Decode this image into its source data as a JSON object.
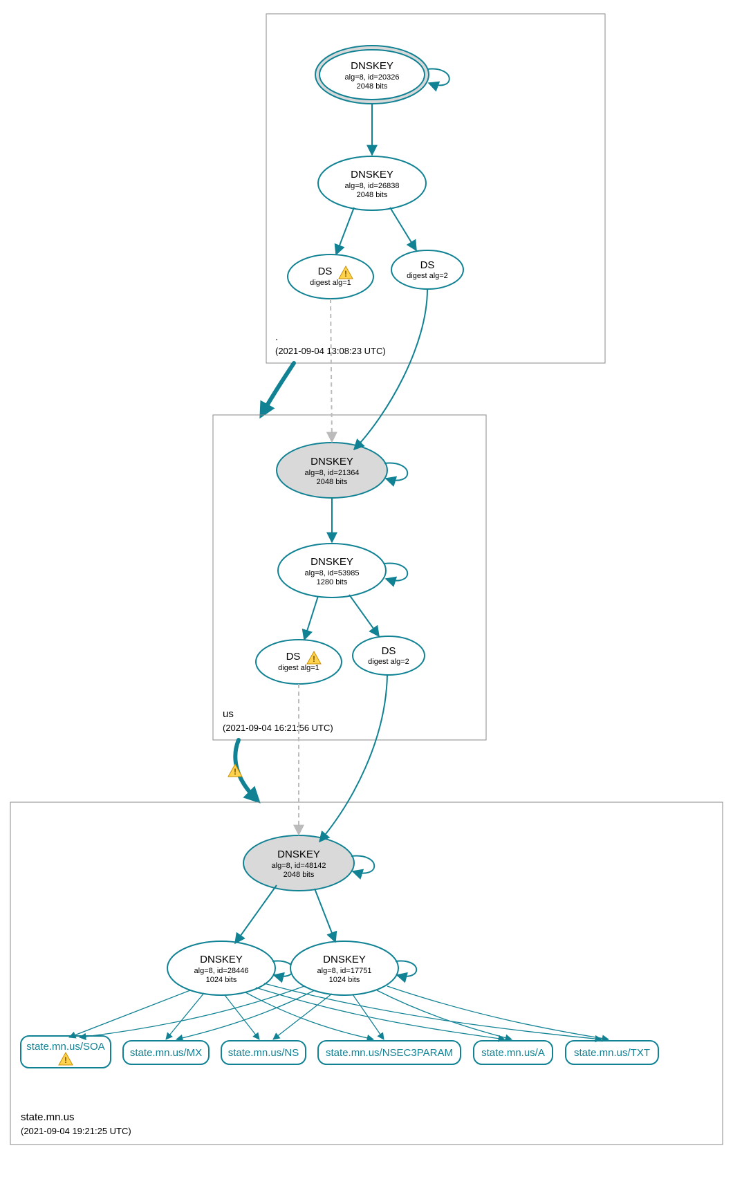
{
  "zones": {
    "root": {
      "name": ".",
      "timestamp": "(2021-09-04 13:08:23 UTC)"
    },
    "us": {
      "name": "us",
      "timestamp": "(2021-09-04 16:21:56 UTC)"
    },
    "statemnus": {
      "name": "state.mn.us",
      "timestamp": "(2021-09-04 19:21:25 UTC)"
    }
  },
  "nodes": {
    "root_ksk": {
      "title": "DNSKEY",
      "sub1": "alg=8, id=20326",
      "sub2": "2048 bits"
    },
    "root_zsk": {
      "title": "DNSKEY",
      "sub1": "alg=8, id=26838",
      "sub2": "2048 bits"
    },
    "root_ds1": {
      "title": "DS",
      "sub1": "digest alg=1"
    },
    "root_ds2": {
      "title": "DS",
      "sub1": "digest alg=2"
    },
    "us_ksk": {
      "title": "DNSKEY",
      "sub1": "alg=8, id=21364",
      "sub2": "2048 bits"
    },
    "us_zsk": {
      "title": "DNSKEY",
      "sub1": "alg=8, id=53985",
      "sub2": "1280 bits"
    },
    "us_ds1": {
      "title": "DS",
      "sub1": "digest alg=1"
    },
    "us_ds2": {
      "title": "DS",
      "sub1": "digest alg=2"
    },
    "mn_ksk": {
      "title": "DNSKEY",
      "sub1": "alg=8, id=48142",
      "sub2": "2048 bits"
    },
    "mn_zsk1": {
      "title": "DNSKEY",
      "sub1": "alg=8, id=28446",
      "sub2": "1024 bits"
    },
    "mn_zsk2": {
      "title": "DNSKEY",
      "sub1": "alg=8, id=17751",
      "sub2": "1024 bits"
    }
  },
  "rrsets": {
    "soa": "state.mn.us/SOA",
    "mx": "state.mn.us/MX",
    "ns": "state.mn.us/NS",
    "nsec3": "state.mn.us/NSEC3PARAM",
    "a": "state.mn.us/A",
    "txt": "state.mn.us/TXT"
  },
  "icons": {
    "warning": "!"
  }
}
